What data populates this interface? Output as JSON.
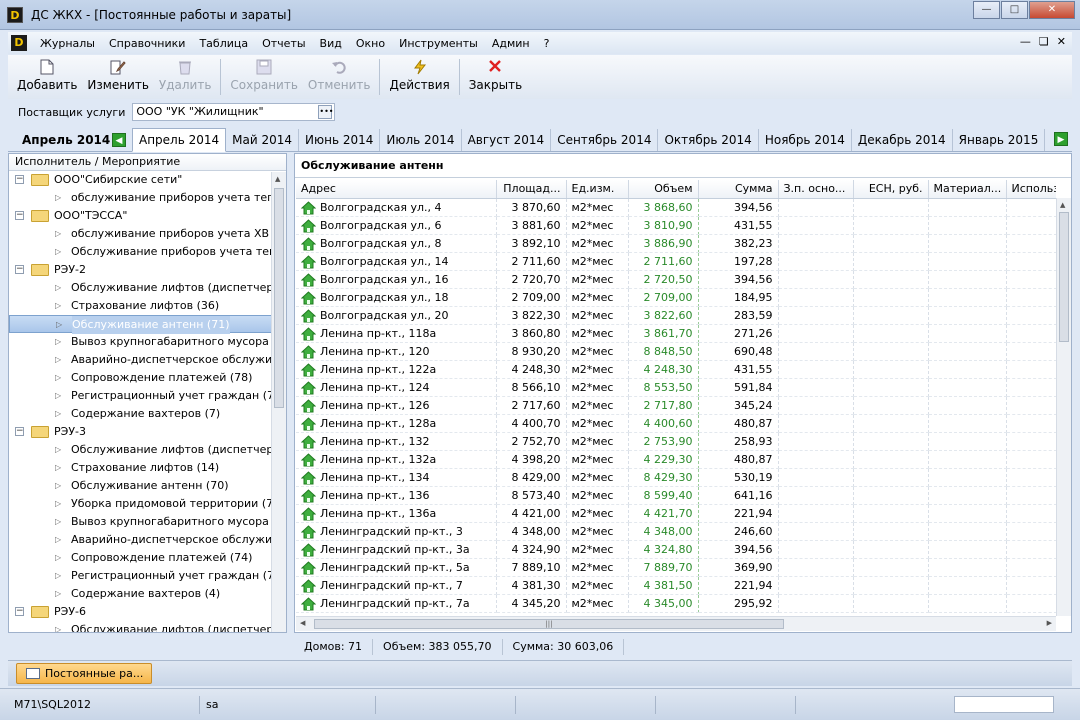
{
  "window": {
    "title": "ДС ЖКХ - [Постоянные работы и зараты]",
    "app_icon": "D"
  },
  "menu": [
    "Журналы",
    "Справочники",
    "Таблица",
    "Отчеты",
    "Вид",
    "Окно",
    "Инструменты",
    "Админ",
    "?"
  ],
  "toolbar": {
    "add": "Добавить",
    "edit": "Изменить",
    "delete": "Удалить",
    "save": "Сохранить",
    "cancel": "Отменить",
    "actions": "Действия",
    "close": "Закрыть"
  },
  "supplier": {
    "label": "Поставщик услуги",
    "value": "ООО \"УК \"Жилищник\""
  },
  "period": {
    "current": "Апрель 2014",
    "tabs": [
      "Апрель 2014",
      "Май 2014",
      "Июнь 2014",
      "Июль 2014",
      "Август 2014",
      "Сентябрь 2014",
      "Октябрь 2014",
      "Ноябрь 2014",
      "Декабрь 2014",
      "Январь 2015"
    ]
  },
  "tree": {
    "header": "Исполнитель / Мероприятие",
    "rows": [
      {
        "type": "group",
        "text": "ООО\"Сибирские сети\""
      },
      {
        "type": "child",
        "text": "обслуживание приборов учета теп..."
      },
      {
        "type": "group",
        "text": "ООО\"ТЭССА\""
      },
      {
        "type": "child",
        "text": "обслуживание приборов учета ХВ (..."
      },
      {
        "type": "child",
        "text": "Обслуживание приборов учета теп..."
      },
      {
        "type": "group",
        "text": "РЭУ-2"
      },
      {
        "type": "child",
        "text": "Обслуживание лифтов (диспетчерс..."
      },
      {
        "type": "child",
        "text": "Страхование лифтов (36)"
      },
      {
        "type": "child",
        "text": "Обслуживание антенн (71)",
        "selected": true
      },
      {
        "type": "child",
        "text": "Вывоз крупногабаритного мусора (..."
      },
      {
        "type": "child",
        "text": "Аварийно-диспетчерское обслужив..."
      },
      {
        "type": "child",
        "text": "Сопровождение платежей (78)"
      },
      {
        "type": "child",
        "text": "Регистрационный учет граждан (78)"
      },
      {
        "type": "child",
        "text": "Содержание вахтеров (7)"
      },
      {
        "type": "group",
        "text": "РЭУ-3"
      },
      {
        "type": "child",
        "text": "Обслуживание лифтов (диспетчерс..."
      },
      {
        "type": "child",
        "text": "Страхование лифтов (14)"
      },
      {
        "type": "child",
        "text": "Обслуживание антенн (70)"
      },
      {
        "type": "child",
        "text": "Уборка придомовой территории (7)"
      },
      {
        "type": "child",
        "text": "Вывоз крупногабаритного мусора (..."
      },
      {
        "type": "child",
        "text": "Аварийно-диспетчерское обслужив..."
      },
      {
        "type": "child",
        "text": "Сопровождение платежей (74)"
      },
      {
        "type": "child",
        "text": "Регистрационный учет граждан (74)"
      },
      {
        "type": "child",
        "text": "Содержание вахтеров (4)"
      },
      {
        "type": "group",
        "text": "РЭУ-6"
      },
      {
        "type": "child",
        "text": "Обслуживание лифтов (диспетчерс..."
      }
    ]
  },
  "grid": {
    "title": "Обслуживание антенн",
    "columns": [
      "Адрес",
      "Площад...",
      "Ед.изм.",
      "Объем",
      "Сумма",
      "З.п. осно...",
      "ЕСН, руб.",
      "Материал...",
      "Использ..."
    ],
    "rows": [
      [
        "Волгоградская ул., 4",
        "3 870,60",
        "м2*мес",
        "3 868,60",
        "394,56"
      ],
      [
        "Волгоградская ул., 6",
        "3 881,60",
        "м2*мес",
        "3 810,90",
        "431,55"
      ],
      [
        "Волгоградская ул., 8",
        "3 892,10",
        "м2*мес",
        "3 886,90",
        "382,23"
      ],
      [
        "Волгоградская ул., 14",
        "2 711,60",
        "м2*мес",
        "2 711,60",
        "197,28"
      ],
      [
        "Волгоградская ул., 16",
        "2 720,70",
        "м2*мес",
        "2 720,50",
        "394,56"
      ],
      [
        "Волгоградская ул., 18",
        "2 709,00",
        "м2*мес",
        "2 709,00",
        "184,95"
      ],
      [
        "Волгоградская ул., 20",
        "3 822,30",
        "м2*мес",
        "3 822,60",
        "283,59"
      ],
      [
        "Ленина пр-кт., 118а",
        "3 860,80",
        "м2*мес",
        "3 861,70",
        "271,26"
      ],
      [
        "Ленина пр-кт., 120",
        "8 930,20",
        "м2*мес",
        "8 848,50",
        "690,48"
      ],
      [
        "Ленина пр-кт., 122а",
        "4 248,30",
        "м2*мес",
        "4 248,30",
        "431,55"
      ],
      [
        "Ленина пр-кт., 124",
        "8 566,10",
        "м2*мес",
        "8 553,50",
        "591,84"
      ],
      [
        "Ленина пр-кт., 126",
        "2 717,60",
        "м2*мес",
        "2 717,80",
        "345,24"
      ],
      [
        "Ленина пр-кт., 128а",
        "4 400,70",
        "м2*мес",
        "4 400,60",
        "480,87"
      ],
      [
        "Ленина пр-кт., 132",
        "2 752,70",
        "м2*мес",
        "2 753,90",
        "258,93"
      ],
      [
        "Ленина пр-кт., 132а",
        "4 398,20",
        "м2*мес",
        "4 229,30",
        "480,87"
      ],
      [
        "Ленина пр-кт., 134",
        "8 429,00",
        "м2*мес",
        "8 429,30",
        "530,19"
      ],
      [
        "Ленина пр-кт., 136",
        "8 573,40",
        "м2*мес",
        "8 599,40",
        "641,16"
      ],
      [
        "Ленина пр-кт., 136а",
        "4 421,00",
        "м2*мес",
        "4 421,70",
        "221,94"
      ],
      [
        "Ленинградский пр-кт., 3",
        "4 348,00",
        "м2*мес",
        "4 348,00",
        "246,60"
      ],
      [
        "Ленинградский пр-кт., 3а",
        "4 324,90",
        "м2*мес",
        "4 324,80",
        "394,56"
      ],
      [
        "Ленинградский пр-кт., 5а",
        "7 889,10",
        "м2*мес",
        "7 889,70",
        "369,90"
      ],
      [
        "Ленинградский пр-кт., 7",
        "4 381,30",
        "м2*мес",
        "4 381,50",
        "221,94"
      ],
      [
        "Ленинградский пр-кт., 7а",
        "4 345,20",
        "м2*мес",
        "4 345,00",
        "295,92"
      ]
    ]
  },
  "summary": {
    "houses": "Домов: 71",
    "volume": "Объем: 383 055,70",
    "sum": "Сумма: 30 603,06"
  },
  "taskbar": {
    "button": "Постоянные ра..."
  },
  "status": {
    "server": "M71\\SQL2012",
    "user": "sa"
  },
  "colors": {
    "accent": "#2a8a2a",
    "selection": "#a9c6ea",
    "task_button": "#f6b64a"
  }
}
